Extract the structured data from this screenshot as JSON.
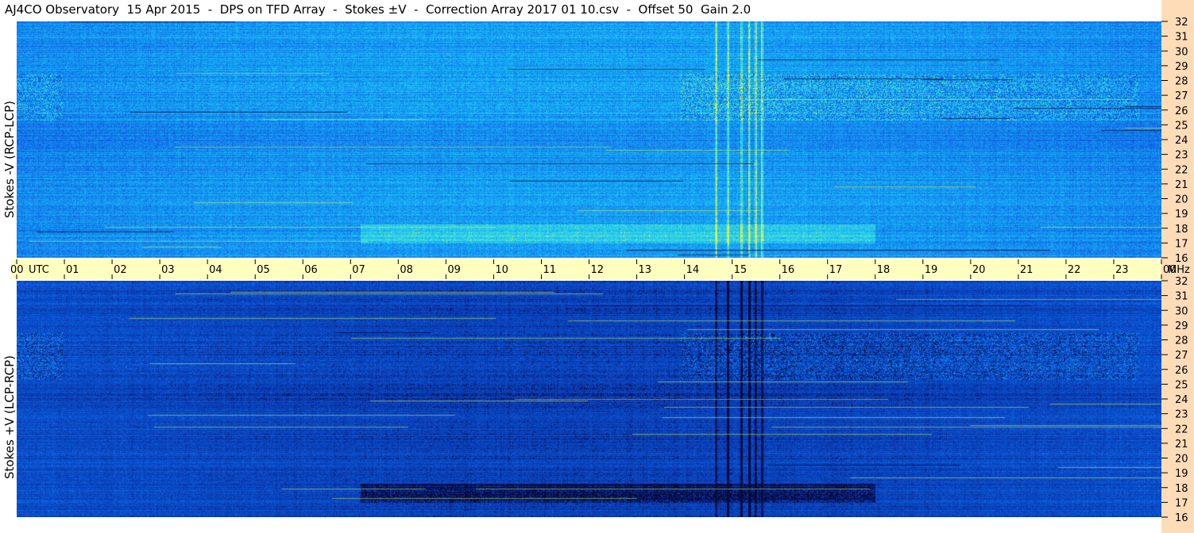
{
  "title": "AJ4CO Observatory  15 Apr 2015  -  DPS on TFD Array  -  Stokes ±V  -  Correction Array 2017 01 10.csv  -  Offset 50  Gain 2.0",
  "colors": {
    "right_strip": "#ffdcb8",
    "time_strip": "#ffffc0",
    "top_panel_base": "#1a8ae8",
    "bottom_panel_base": "#1558d8"
  },
  "chart_data": [
    {
      "type": "heatmap",
      "ylabel": "Stokes -V (RCP-LCP)",
      "x_range_utc_hours": [
        0,
        24
      ],
      "y_range_mhz": [
        16,
        32
      ],
      "y_ticks": [
        "16",
        "17",
        "18",
        "19",
        "20",
        "21",
        "22",
        "23",
        "24",
        "25",
        "26",
        "27",
        "28",
        "29",
        "30",
        "31",
        "32"
      ]
    },
    {
      "type": "heatmap",
      "ylabel": "Stokes +V (LCP-RCP)",
      "x_range_utc_hours": [
        0,
        24
      ],
      "y_range_mhz": [
        16,
        32
      ],
      "y_ticks": [
        "16",
        "17",
        "18",
        "19",
        "20",
        "21",
        "22",
        "23",
        "24",
        "25",
        "26",
        "27",
        "28",
        "29",
        "30",
        "31",
        "32"
      ]
    }
  ],
  "x_axis": {
    "unit_label": "UTC",
    "freq_unit_label": "MHz",
    "ticks": [
      "00",
      "01",
      "02",
      "03",
      "04",
      "05",
      "06",
      "07",
      "08",
      "09",
      "10",
      "11",
      "12",
      "13",
      "14",
      "15",
      "16",
      "17",
      "18",
      "19",
      "20",
      "21",
      "22",
      "23",
      "00"
    ]
  }
}
